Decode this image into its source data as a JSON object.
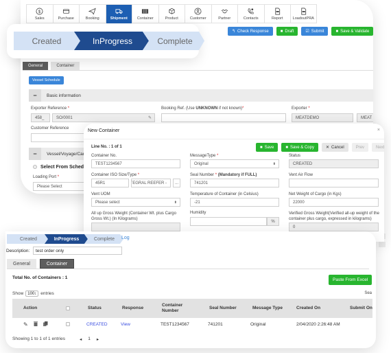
{
  "nav": {
    "items": [
      {
        "label": "Sales",
        "icon": "dollar-icon"
      },
      {
        "label": "Purchase",
        "icon": "credit-card-icon"
      },
      {
        "label": "Booking",
        "icon": "paper-plane-icon"
      },
      {
        "label": "Shipment",
        "icon": "truck-icon",
        "active": true
      },
      {
        "label": "Container",
        "icon": "container-icon"
      },
      {
        "label": "Product",
        "icon": "product-box-icon"
      },
      {
        "label": "Customer",
        "icon": "customer-icon"
      },
      {
        "label": "Partner",
        "icon": "handshake-icon"
      },
      {
        "label": "Contacts",
        "icon": "phone-icon"
      },
      {
        "label": "Report",
        "icon": "document-icon"
      },
      {
        "label": "LoadoutPRA",
        "icon": "document-icon"
      }
    ]
  },
  "toolbar": {
    "check_response": "Check Response",
    "draft": "Draft",
    "submit": "Submit",
    "save_validate": "Save & Validate"
  },
  "status_steps": {
    "created": "Created",
    "in_progress": "InProgress",
    "complete": "Complete"
  },
  "colors": {
    "active_step": "#1f4b8f",
    "inactive_step": "#d4e2f5",
    "primary": "#3a86d9",
    "success": "#28b52f",
    "nav_active": "#1d5fb3"
  },
  "back_form": {
    "tabs": [
      "General",
      "Container"
    ],
    "vessel_schedule": "Vessel Schedule",
    "basic_info": "Basic information",
    "exporter_ref_label": "Exporter Reference",
    "exporter_ref_prefix": "458_",
    "exporter_ref_value": "SO/0001",
    "booking_ref_label_pre": "Booking Ref. (Use ",
    "booking_ref_label_bold": "UNKNOWN",
    "booking_ref_label_post": " if not known)",
    "booking_ref_value": "",
    "exporter_label": "Exporter",
    "exporter_value": "MEATDEMO",
    "exporter_value2": "MEAT",
    "customer_ref_label": "Customer Reference",
    "vessel_section": "Vessel/Voyage/Carg",
    "select_from_schedule": "Select From Schedu",
    "loading_port_label": "Loading Port",
    "loading_port_value": "Please Select",
    "required_mark": "*"
  },
  "modal": {
    "title": "New Container",
    "close": "×",
    "line_no": "Line No. : 1 of 1",
    "buttons": {
      "save": "Save",
      "save_copy": "Save & Copy",
      "cancel": "Cancel",
      "prev": "Prev",
      "next": "Next"
    },
    "fields": {
      "container_no_label": "Container No.",
      "container_no": "TEST1234567",
      "message_type_label": "MessageType",
      "message_type": "Original",
      "status_label": "Status",
      "status": "CREATED",
      "iso_label": "Container ISO Size/Type",
      "iso_code": "45R1",
      "iso_desc": "INTEGRAL REEFER -",
      "iso_more": "...",
      "seal_label": "Seal Number",
      "seal_label_note": " (Mandatory if FULL)",
      "seal": "741201",
      "vent_air_label": "Vent Air Flow",
      "vent_air": "",
      "vent_uom_label": "Vent UOM",
      "vent_uom": "Please select",
      "temp_label": "Temperature of Container (in Celsius)",
      "temp": "-21",
      "net_weight_label": "Net Weight of Cargo (in Kgs)",
      "net_weight": "22000",
      "gross_label": "All up Gross Weight (Container Wt. plus Cargo Gross Wt.) (In Kilograms)",
      "gross": "",
      "humidity_label": "Humidity",
      "humidity": "",
      "humidity_unit": "%",
      "vgm_label": "Verified Gross Weight(Verified all-up weight of the container plus cargo, expressed in kilograms)",
      "vgm": "0"
    }
  },
  "list": {
    "steps": {
      "created": "Created",
      "in_progress": "InProgress",
      "complete": "Complete"
    },
    "log": "Log",
    "description_label": "Description:",
    "description_value": "test order only",
    "tabs": [
      "General",
      "Container"
    ],
    "total": "Total No. of Containers : 1",
    "paste_excel": "Paste From Excel",
    "show_pre": "Show",
    "show_value": "100",
    "show_post": "entries",
    "search_partial": "Sea",
    "columns": [
      "Action",
      "",
      "Status",
      "Response",
      "Container Number",
      "Seal Number",
      "Message Type",
      "Created On",
      "Submit On"
    ],
    "rows": [
      {
        "status": "CREATED",
        "response": "View",
        "container": "TEST1234567",
        "seal": "741201",
        "message_type": "Original",
        "created_on": "2/04/2020 2:26:48 AM",
        "submit_on": ""
      }
    ],
    "showing": "Showing 1 to 1 of 1 entries",
    "page": "1"
  }
}
